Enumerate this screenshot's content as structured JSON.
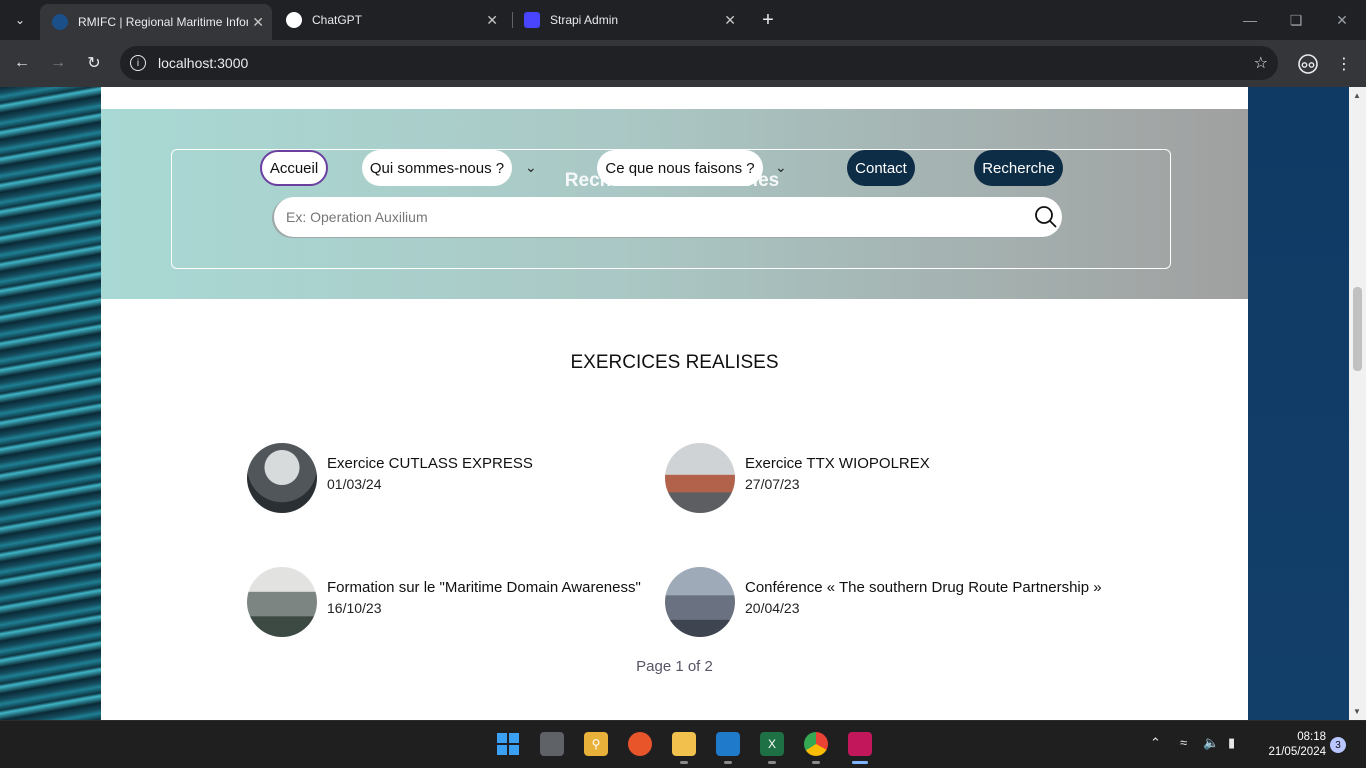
{
  "browser": {
    "tabs": [
      {
        "title": "RMIFC | Regional Maritime Infor",
        "active": true,
        "favicon_color": "#1a4f8a"
      },
      {
        "title": "ChatGPT",
        "active": false,
        "favicon_color": "#ffffff"
      },
      {
        "title": "Strapi Admin",
        "active": false,
        "favicon_color": "#4945ff"
      }
    ],
    "url": "localhost:3000"
  },
  "hero": {
    "heading": "Rechercher des articles",
    "nav": {
      "home": "Accueil",
      "about": "Qui sommes-nous ?",
      "activities": "Ce que nous faisons ?",
      "contact": "Contact",
      "search": "Recherche"
    },
    "search_placeholder": "Ex: Operation Auxilium"
  },
  "section": {
    "title": "EXERCICES REALISES",
    "items": [
      {
        "title": "Exercice CUTLASS EXPRESS",
        "date": "01/03/24"
      },
      {
        "title": "Exercice TTX WIOPOLREX",
        "date": "27/07/23"
      },
      {
        "title": "Formation sur le \"Maritime Domain Awareness\"",
        "date": "16/10/23"
      },
      {
        "title": "Conférence « The southern Drug Route Partnership »",
        "date": "20/04/23"
      }
    ],
    "pagination": "Page 1 of 2"
  },
  "taskbar": {
    "time": "08:18",
    "date": "21/05/2024",
    "notifications": "3"
  },
  "colors": {
    "nav_dark": "#0d2c45",
    "home_border": "#6b3fa0",
    "right_panel": "#0f3a64"
  }
}
